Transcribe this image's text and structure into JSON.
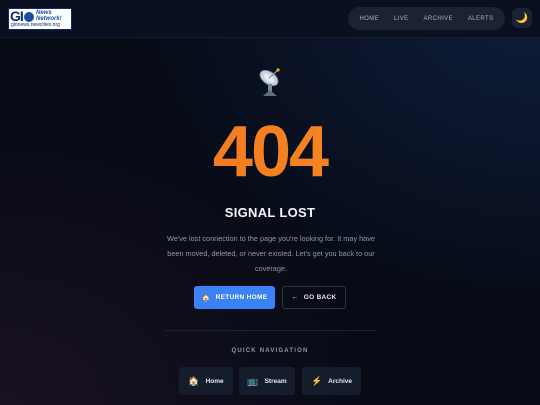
{
  "brand": {
    "logo_mark": "GI",
    "logo_tagline": "News Network!",
    "logo_url": "glonews.newcities.org"
  },
  "nav": {
    "items": [
      "HOME",
      "LIVE",
      "ARCHIVE",
      "ALERTS"
    ]
  },
  "theme_toggle": {
    "icon": "moon-icon",
    "glyph": "🌙"
  },
  "error": {
    "icon": "satellite-dish-icon",
    "code": "404",
    "title": "SIGNAL LOST",
    "message": "We've lost connection to the page you're looking for. It may have been moved, deleted, or never existed. Let's get you back to our coverage."
  },
  "actions": {
    "primary": {
      "icon": "🏠",
      "label": "RETURN HOME"
    },
    "secondary": {
      "icon": "←",
      "label": "GO BACK"
    }
  },
  "quick_nav": {
    "label": "QUICK NAVIGATION",
    "items": [
      {
        "icon": "🏠",
        "label": "Home"
      },
      {
        "icon": "📺",
        "label": "Stream"
      },
      {
        "icon": "⚡",
        "label": "Archive"
      }
    ]
  },
  "colors": {
    "accent": "#3b82f6",
    "code_gradient_start": "#f06a2c",
    "code_gradient_end": "#f08f25",
    "background": "#070b16"
  }
}
